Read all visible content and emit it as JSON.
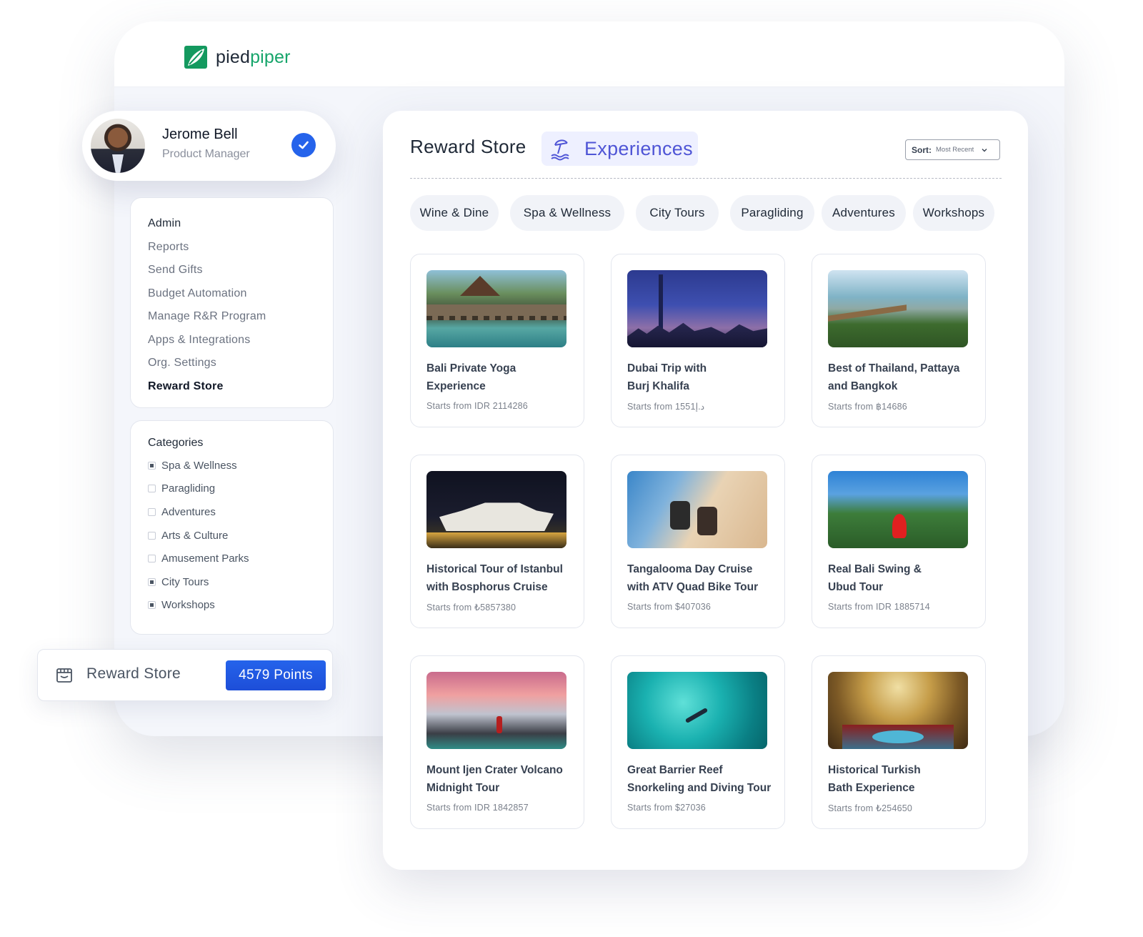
{
  "brand": {
    "name_part1": "pied",
    "name_part2": "piper",
    "accent": "#17a56b"
  },
  "profile": {
    "name": "Jerome Bell",
    "role": "Product Manager",
    "verified_icon": "check-circle-icon"
  },
  "nav": {
    "items": [
      {
        "label": "Admin"
      },
      {
        "label": "Reports"
      },
      {
        "label": "Send Gifts"
      },
      {
        "label": "Budget Automation"
      },
      {
        "label": "Manage R&R Program"
      },
      {
        "label": "Apps & Integrations"
      },
      {
        "label": "Org. Settings"
      },
      {
        "label": "Reward Store",
        "active": true
      }
    ]
  },
  "categories": {
    "title": "Categories",
    "items": [
      {
        "label": "Spa & Wellness",
        "checked": true
      },
      {
        "label": "Paragliding",
        "checked": false
      },
      {
        "label": "Adventures",
        "checked": false
      },
      {
        "label": "Arts & Culture",
        "checked": false
      },
      {
        "label": "Amusement Parks",
        "checked": false
      },
      {
        "label": "City Tours",
        "checked": true
      },
      {
        "label": "Workshops",
        "checked": true
      }
    ]
  },
  "points": {
    "label": "Reward Store",
    "button": "4579 Points",
    "button_color": "#1d4ed8",
    "icon": "store-icon"
  },
  "store": {
    "title": "Reward Store",
    "section": "Experiences",
    "section_icon": "beach-umbrella-icon",
    "sort": {
      "label": "Sort:",
      "value": "Most Recent"
    },
    "tabs": [
      "Wine & Dine",
      "Spa & Wellness",
      "City Tours",
      "Paragliding",
      "Adventures",
      "Workshops"
    ],
    "experiences": [
      {
        "title_line1": "Bali Private Yoga",
        "title_line2": "Experience",
        "price": "Starts from IDR 2114286"
      },
      {
        "title_line1": "Dubai Trip with",
        "title_line2": "Burj Khalifa",
        "price": "Starts from 1551د.إ"
      },
      {
        "title_line1": "Best of Thailand, Pattaya",
        "title_line2": "and Bangkok",
        "price": "Starts from ฿14686"
      },
      {
        "title_line1": "Historical Tour of Istanbul",
        "title_line2": "with Bosphorus Cruise",
        "price": "Starts from ₺5857380"
      },
      {
        "title_line1": "Tangalooma Day Cruise",
        "title_line2": "with ATV Quad Bike Tour",
        "price": "Starts from $407036"
      },
      {
        "title_line1": "Real Bali Swing &",
        "title_line2": "Ubud Tour",
        "price": "Starts from IDR 1885714"
      },
      {
        "title_line1": "Mount Ijen Crater Volcano",
        "title_line2": "Midnight Tour",
        "price": "Starts from IDR 1842857"
      },
      {
        "title_line1": "Great Barrier Reef",
        "title_line2": "Snorkeling and Diving Tour",
        "price": "Starts from $27036"
      },
      {
        "title_line1": "Historical Turkish",
        "title_line2": "Bath Experience",
        "price": "Starts from ₺254650"
      }
    ]
  }
}
